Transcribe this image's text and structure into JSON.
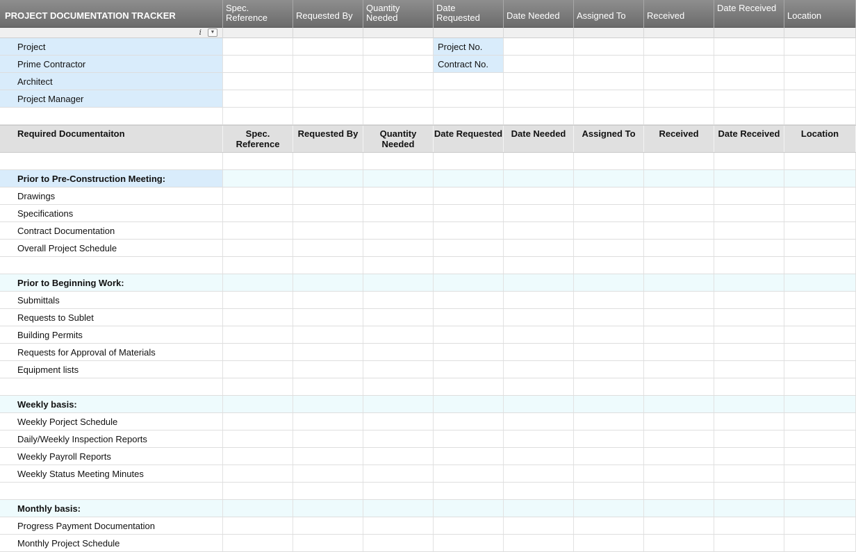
{
  "header": {
    "title": "PROJECT DOCUMENTATION TRACKER",
    "columns": [
      "Spec. Reference",
      "Requested By",
      "Quantity Needed",
      "Date Requested",
      "Date Needed",
      "Assigned To",
      "Received",
      "Date Received",
      "Location"
    ]
  },
  "info_icon": "i",
  "info": {
    "project": "Project",
    "prime_contractor": "Prime Contractor",
    "architect": "Architect",
    "project_manager": "Project Manager",
    "project_no": "Project No.",
    "contract_no": "Contract No."
  },
  "table_header": {
    "first": "Required Documentaiton",
    "columns": [
      "Spec. Reference",
      "Requested By",
      "Quantity Needed",
      "Date Requested",
      "Date Needed",
      "Assigned To",
      "Received",
      "Date Received",
      "Location"
    ]
  },
  "sections": [
    {
      "title": "Prior to Pre-Construction Meeting:",
      "items": [
        "Drawings",
        "Specifications",
        "Contract Documentation",
        "Overall Project Schedule"
      ]
    },
    {
      "title": "Prior to Beginning Work:",
      "items": [
        "Submittals",
        "Requests to Sublet",
        "Building Permits",
        "Requests for Approval of Materials",
        "Equipment lists"
      ]
    },
    {
      "title": "Weekly basis:",
      "items": [
        "Weekly Porject Schedule",
        "Daily/Weekly Inspection Reports",
        "Weekly Payroll Reports",
        "Weekly Status Meeting Minutes"
      ]
    },
    {
      "title": "Monthly basis:",
      "items": [
        "Progress Payment Documentation",
        "Monthly Project Schedule"
      ]
    }
  ],
  "colors": {
    "header_bg": "#7a7a7a",
    "info_blue": "#d9ecfb",
    "section_bg": "#eefbfd",
    "table_header_bg": "#e0e0e0"
  }
}
